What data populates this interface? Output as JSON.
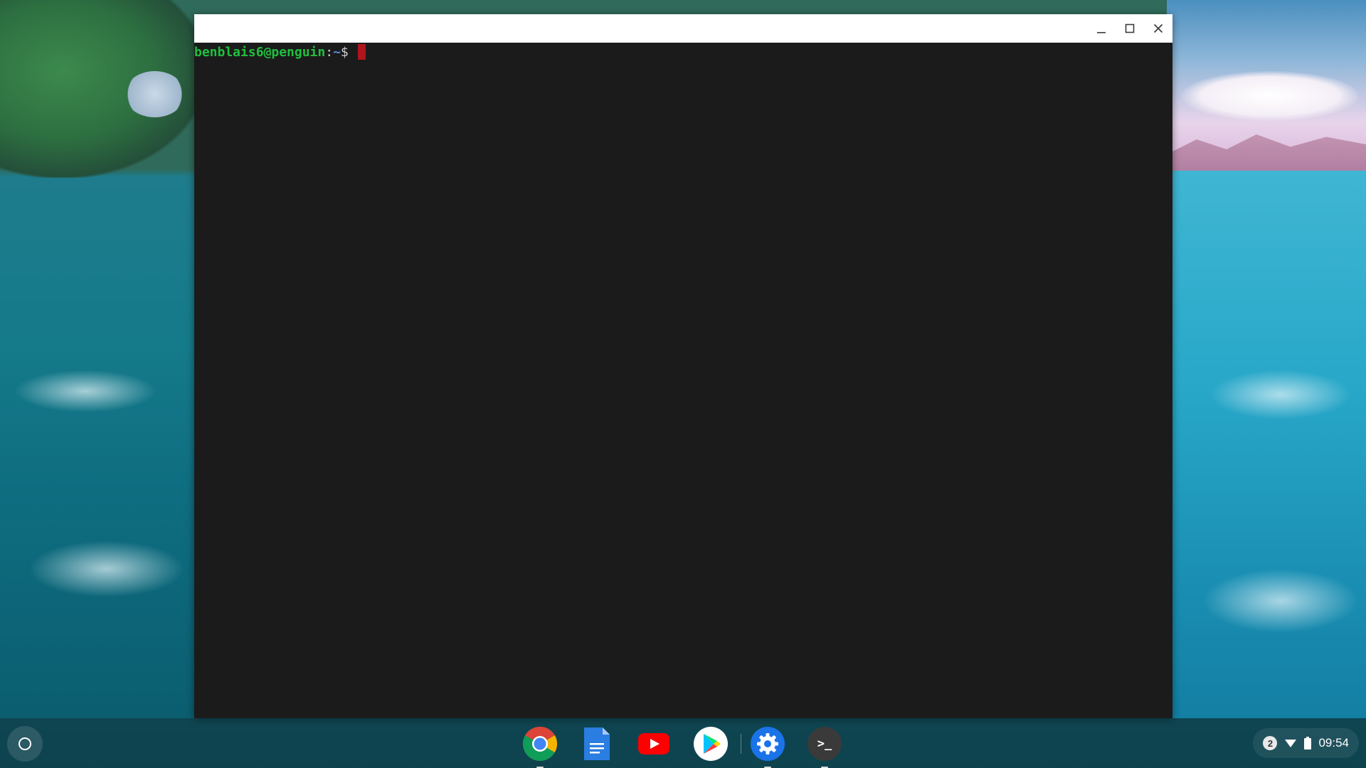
{
  "terminal": {
    "user_host": "benblais6@penguin",
    "separator": ":",
    "path": "~",
    "prompt_symbol": "$ "
  },
  "window_controls": {
    "minimize": "minimize-icon",
    "maximize": "maximize-icon",
    "close": "close-icon"
  },
  "shelf": {
    "apps": [
      {
        "name": "chrome",
        "icon": "chrome-icon",
        "running": true
      },
      {
        "name": "docs",
        "icon": "docs-icon",
        "running": false
      },
      {
        "name": "youtube",
        "icon": "youtube-icon",
        "running": false
      },
      {
        "name": "play-store",
        "icon": "play-store-icon",
        "running": false
      },
      {
        "name": "settings",
        "icon": "settings-icon",
        "running": true
      },
      {
        "name": "terminal",
        "icon": "terminal-icon",
        "label": ">_",
        "running": true
      }
    ]
  },
  "status": {
    "notification_count": "2",
    "time": "09:54"
  },
  "colors": {
    "prompt_user": "#1fbf3f",
    "prompt_path": "#5a8be0",
    "cursor": "#b0141c",
    "terminal_bg": "#1b1b1b"
  }
}
